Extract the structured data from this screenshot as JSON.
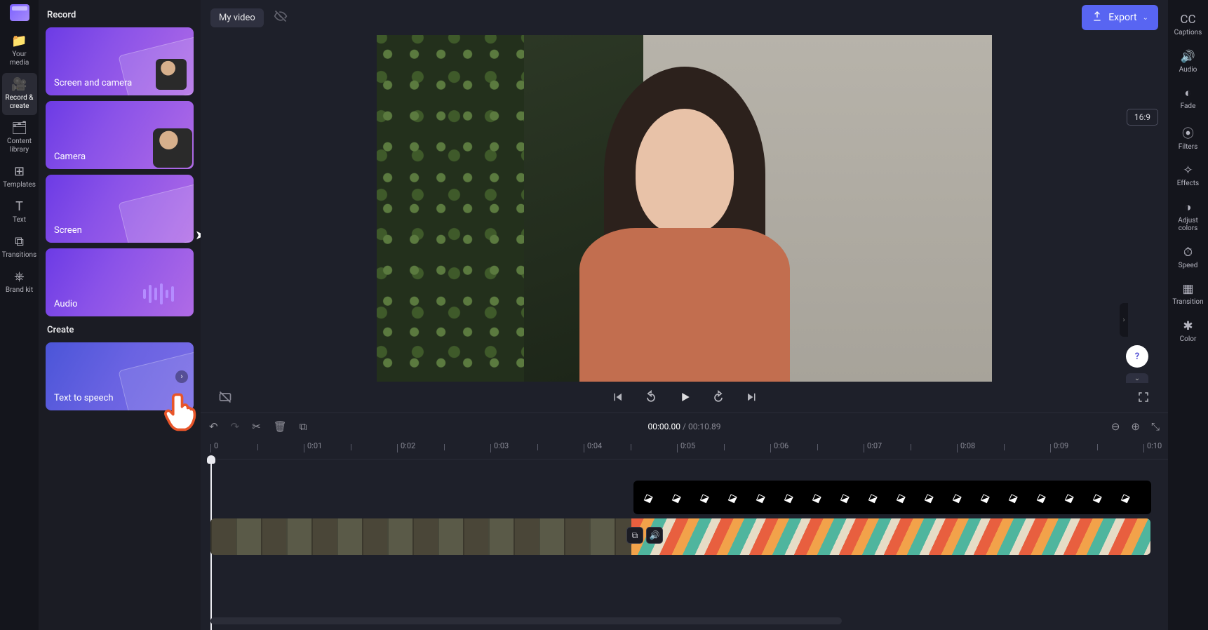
{
  "project": {
    "title": "My video"
  },
  "export_label": "Export",
  "aspect_label": "16:9",
  "nav_rail": [
    {
      "id": "your-media",
      "label": "Your media",
      "icon": "📁"
    },
    {
      "id": "record-create",
      "label": "Record & create",
      "icon": "🎥"
    },
    {
      "id": "content-library",
      "label": "Content library",
      "icon": "🗂"
    },
    {
      "id": "templates",
      "label": "Templates",
      "icon": "⊞"
    },
    {
      "id": "text",
      "label": "Text",
      "icon": "T"
    },
    {
      "id": "transitions",
      "label": "Transitions",
      "icon": "⧉"
    },
    {
      "id": "brand-kit",
      "label": "Brand kit",
      "icon": "⎈"
    }
  ],
  "record_panel": {
    "heading_record": "Record",
    "heading_create": "Create",
    "items": [
      {
        "label": "Screen and camera"
      },
      {
        "label": "Camera"
      },
      {
        "label": "Screen"
      },
      {
        "label": "Audio"
      }
    ],
    "create_items": [
      {
        "label": "Text to speech"
      }
    ]
  },
  "right_rail": [
    {
      "id": "captions",
      "label": "Captions",
      "icon": "CC"
    },
    {
      "id": "audio",
      "label": "Audio",
      "icon": "🔊"
    },
    {
      "id": "fade",
      "label": "Fade",
      "icon": "◐"
    },
    {
      "id": "filters",
      "label": "Filters",
      "icon": "⦿"
    },
    {
      "id": "effects",
      "label": "Effects",
      "icon": "✧"
    },
    {
      "id": "adjust-colors",
      "label": "Adjust colors",
      "icon": "◑"
    },
    {
      "id": "speed",
      "label": "Speed",
      "icon": "⏱"
    },
    {
      "id": "transition",
      "label": "Transition",
      "icon": "▦"
    },
    {
      "id": "color",
      "label": "Color",
      "icon": "✱"
    }
  ],
  "playback": {
    "current": "00:00.00",
    "duration": "00:10.89"
  },
  "timeline": {
    "ticks": [
      "0",
      "0:01",
      "0:02",
      "0:03",
      "0:04",
      "0:05",
      "0:06",
      "0:07",
      "0:08",
      "0:09",
      "0:10"
    ]
  }
}
